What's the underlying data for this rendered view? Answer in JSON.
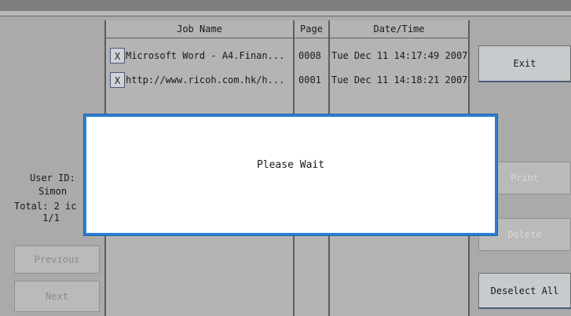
{
  "table": {
    "headers": {
      "job_name": "Job Name",
      "page": "Page",
      "datetime": "Date/Time"
    },
    "rows": [
      {
        "select": "X",
        "job_name": "Microsoft Word - A4.Finan...",
        "page": "0008",
        "datetime": "Tue Dec 11 14:17:49 2007"
      },
      {
        "select": "X",
        "job_name": "http://www.ricoh.com.hk/h...",
        "page": "0001",
        "datetime": "Tue Dec 11 14:18:21 2007"
      }
    ]
  },
  "left_panel": {
    "user_id_label": "User ID:",
    "user_name": "Simon",
    "total": "Total: 2 ic",
    "page_indicator": "1/1",
    "previous": "Previous",
    "next": "Next"
  },
  "right_panel": {
    "exit": "Exit",
    "print": "Print",
    "delete": "Delete",
    "deselect_all": "Deselect All"
  },
  "dialog": {
    "message": "Please Wait"
  }
}
